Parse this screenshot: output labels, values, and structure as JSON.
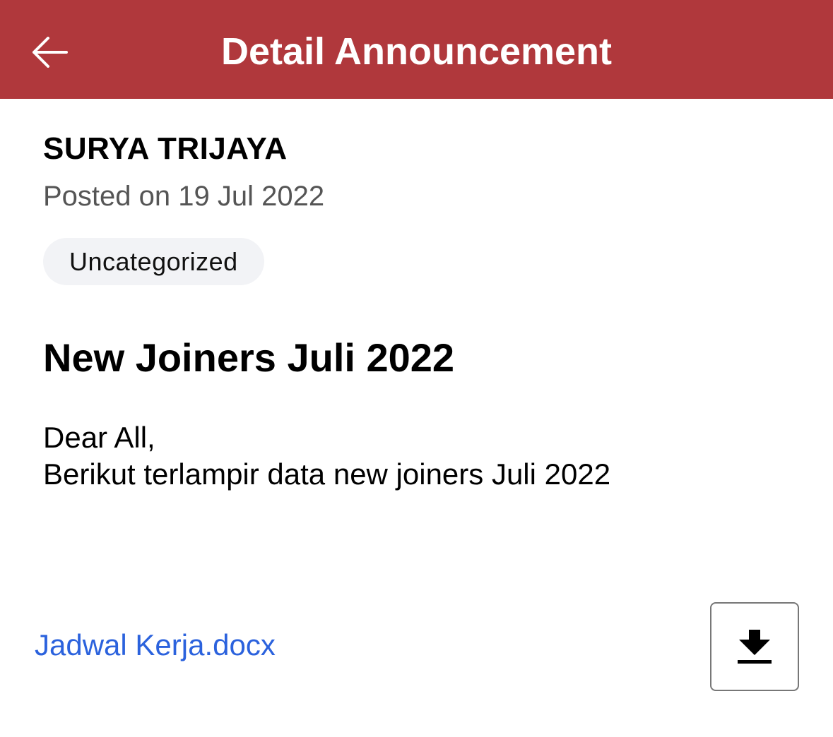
{
  "header": {
    "title": "Detail Announcement",
    "back_icon": "arrow-left-icon",
    "background_color": "#b0383c"
  },
  "announcement": {
    "author": "SURYA TRIJAYA",
    "posted": "Posted on 19 Jul 2022",
    "category": "Uncategorized",
    "title": "New Joiners Juli 2022",
    "body_lines": [
      "Dear All,",
      "Berikut terlampir data new joiners Juli 2022"
    ]
  },
  "attachment": {
    "filename": "Jadwal Kerja.docx",
    "link_color": "#2b62dd",
    "download_icon": "download-icon"
  }
}
